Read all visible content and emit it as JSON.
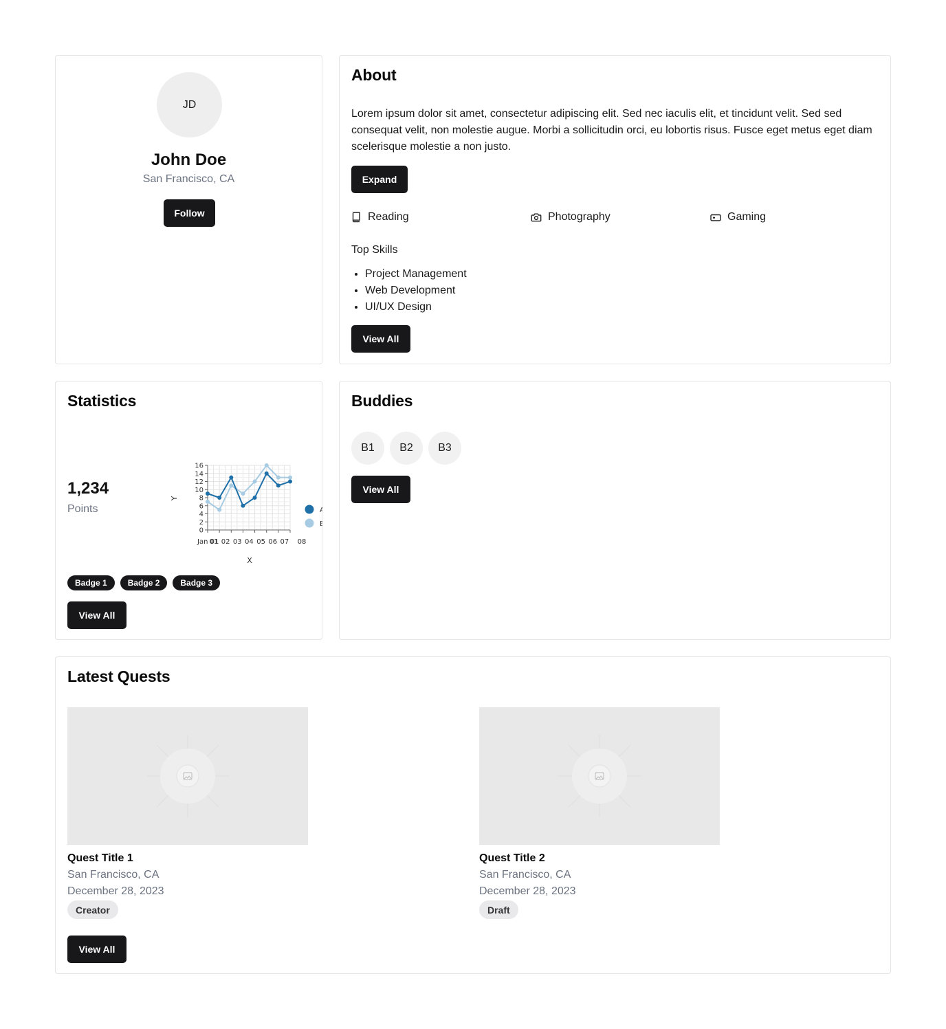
{
  "profile": {
    "initials": "JD",
    "name": "John Doe",
    "location": "San Francisco, CA",
    "follow_label": "Follow"
  },
  "about": {
    "title": "About",
    "text": "Lorem ipsum dolor sit amet, consectetur adipiscing elit. Sed nec iaculis elit, et tincidunt velit. Sed sed consequat velit, non molestie augue. Morbi a sollicitudin orci, eu lobortis risus. Fusce eget metus eget diam scelerisque molestie a non justo.",
    "expand_label": "Expand",
    "hobbies": [
      {
        "label": "Reading",
        "icon": "book-icon"
      },
      {
        "label": "Photography",
        "icon": "camera-icon"
      },
      {
        "label": "Gaming",
        "icon": "gamepad-icon"
      }
    ],
    "skills_title": "Top Skills",
    "skills": [
      "Project Management",
      "Web Development",
      "UI/UX Design"
    ],
    "view_all_label": "View All"
  },
  "statistics": {
    "title": "Statistics",
    "points_value": "1,234",
    "points_label": "Points",
    "badges": [
      "Badge 1",
      "Badge 2",
      "Badge 3"
    ],
    "view_all_label": "View All"
  },
  "chart_data": {
    "type": "line",
    "xlabel": "X",
    "ylabel": "Y",
    "x": [
      "Jan 01",
      "Jan 02",
      "Jan 03",
      "Jan 04",
      "Jan 05",
      "Jan 06",
      "Jan 07",
      "Jan 08"
    ],
    "x_tick_labels": [
      "Jan 01",
      "01",
      "02",
      "03",
      "04",
      "05",
      "06",
      "07",
      "08"
    ],
    "ylim": [
      0,
      16
    ],
    "y_ticks": [
      0,
      2,
      4,
      6,
      8,
      10,
      12,
      14,
      16
    ],
    "grid": true,
    "legend_position": "right",
    "series": [
      {
        "name": "A",
        "color": "#1f6fa8",
        "values": [
          9,
          8,
          13,
          6,
          8,
          14,
          11,
          12
        ]
      },
      {
        "name": "B",
        "color": "#a6cbe3",
        "values": [
          7,
          5,
          11,
          9,
          12,
          16,
          13,
          13
        ]
      }
    ]
  },
  "buddies": {
    "title": "Buddies",
    "items": [
      "B1",
      "B2",
      "B3"
    ],
    "view_all_label": "View All"
  },
  "quests": {
    "title": "Latest Quests",
    "items": [
      {
        "title": "Quest Title 1",
        "location": "San Francisco, CA",
        "date": "December 28, 2023",
        "tag": "Creator"
      },
      {
        "title": "Quest Title 2",
        "location": "San Francisco, CA",
        "date": "December 28, 2023",
        "tag": "Draft"
      }
    ],
    "view_all_label": "View All"
  },
  "colors": {
    "button_bg": "#18181b",
    "muted_text": "#6b7280",
    "card_border": "#e4e4e7"
  }
}
